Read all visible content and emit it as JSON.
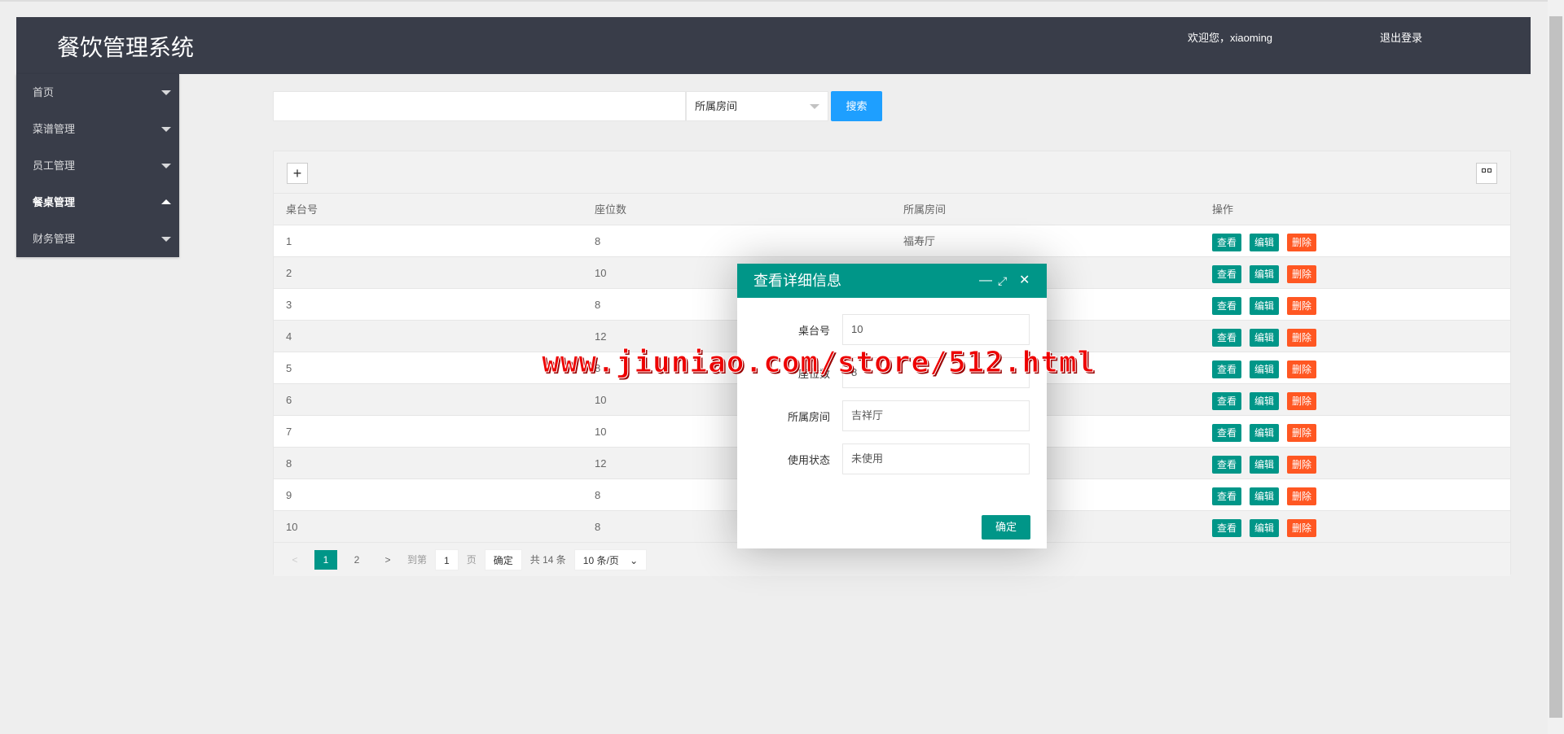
{
  "header": {
    "title": "餐饮管理系统",
    "welcome": "欢迎您，xiaoming",
    "logout": "退出登录"
  },
  "sidebar": {
    "items": [
      {
        "label": "首页"
      },
      {
        "label": "菜谱管理"
      },
      {
        "label": "员工管理"
      },
      {
        "label": "餐桌管理"
      },
      {
        "label": "财务管理"
      }
    ]
  },
  "search": {
    "value": "",
    "select_value": "所属房间",
    "button": "搜索"
  },
  "table": {
    "columns": [
      "桌台号",
      "座位数",
      "所属房间",
      "操作"
    ],
    "actions": {
      "view": "查看",
      "edit": "编辑",
      "delete": "删除"
    },
    "rows": [
      [
        "1",
        "8",
        "福寿厅"
      ],
      [
        "2",
        "10",
        ""
      ],
      [
        "3",
        "8",
        ""
      ],
      [
        "4",
        "12",
        ""
      ],
      [
        "5",
        "8",
        ""
      ],
      [
        "6",
        "10",
        ""
      ],
      [
        "7",
        "10",
        ""
      ],
      [
        "8",
        "12",
        ""
      ],
      [
        "9",
        "8",
        ""
      ],
      [
        "10",
        "8",
        ""
      ]
    ]
  },
  "pager": {
    "pages": [
      "1",
      "2"
    ],
    "goto_label": "到第",
    "goto_value": "1",
    "page_unit": "页",
    "confirm": "确定",
    "total": "共 14 条",
    "page_size": "10 条/页"
  },
  "dialog": {
    "title": "查看详细信息",
    "fields": [
      {
        "label": "桌台号",
        "value": "10"
      },
      {
        "label": "座位数",
        "value": "8"
      },
      {
        "label": "所属房间",
        "value": "吉祥厅"
      },
      {
        "label": "使用状态",
        "value": "未使用"
      }
    ],
    "ok": "确定"
  },
  "watermark": "www.jiuniao.com/store/512.html",
  "colors": {
    "header": "#393d49",
    "primary": "#009688",
    "danger": "#ff5722",
    "search": "#1e9fff"
  }
}
